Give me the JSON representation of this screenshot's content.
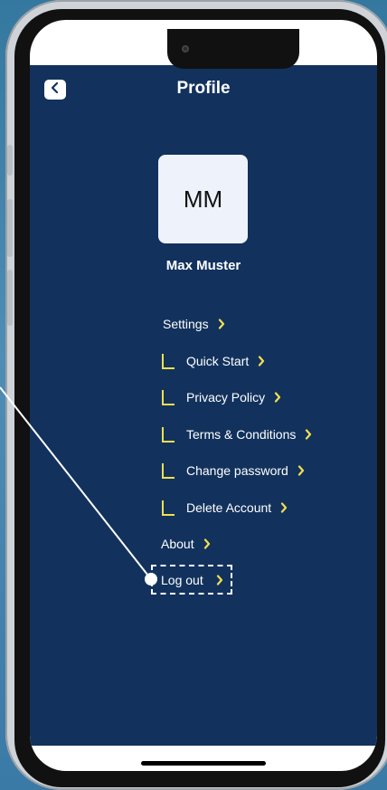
{
  "header": {
    "title": "Profile"
  },
  "profile": {
    "initials": "MM",
    "name": "Max Muster"
  },
  "menu": {
    "items": [
      {
        "label": "Settings",
        "nested": false
      },
      {
        "label": "Quick Start",
        "nested": true
      },
      {
        "label": "Privacy Policy",
        "nested": true
      },
      {
        "label": "Terms & Conditions",
        "nested": true
      },
      {
        "label": "Change password",
        "nested": true
      },
      {
        "label": "Delete Account",
        "nested": true
      },
      {
        "label": "About",
        "nested": false
      },
      {
        "label": "Log out",
        "nested": false
      }
    ]
  },
  "colors": {
    "background": "#12325d",
    "accent_chevron": "#f3df4f",
    "avatar_bg": "#eef2fb"
  },
  "icons": {
    "back": "chevron-left-icon",
    "next": "chevron-right-icon",
    "branch": "tree-branch-icon"
  }
}
